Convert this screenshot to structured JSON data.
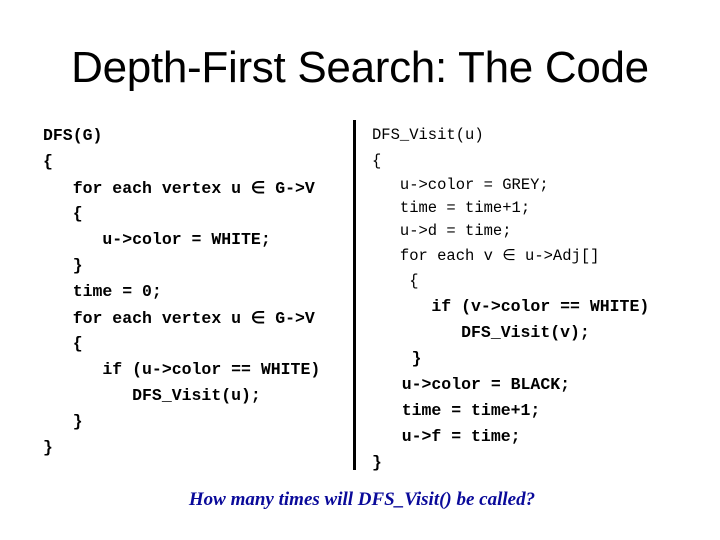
{
  "slide": {
    "title": "Depth-First Search: The Code",
    "question": "How many times will DFS_Visit() be called?",
    "question_color": "#0a0a9a"
  },
  "left_code": {
    "lines": [
      "DFS(G)",
      "{",
      "   for each vertex u ∈ G->V",
      "   {",
      "      u->color = WHITE;",
      "   }",
      "   time = 0;",
      "   for each vertex u ∈ G->V",
      "   {",
      "      if (u->color == WHITE)",
      "         DFS_Visit(u);",
      "   }",
      "}"
    ]
  },
  "right_code": {
    "lines": [
      "DFS_Visit(u)",
      "{",
      "   u->color = GREY;",
      "   time = time+1;",
      "   u->d = time;",
      "   for each v ∈ u->Adj[]",
      "    {",
      "      if (v->color == WHITE)",
      "         DFS_Visit(v);",
      "    }",
      "   u->color = BLACK;",
      "   time = time+1;",
      "   u->f = time;",
      "}"
    ]
  }
}
